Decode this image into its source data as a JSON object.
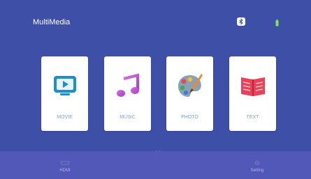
{
  "header": {
    "title": "MultiMedia",
    "bluetooth_icon": "bluetooth-icon",
    "battery_icon": "battery-icon"
  },
  "cards": [
    {
      "label": "MOVIE",
      "icon": "tv-play-icon"
    },
    {
      "label": "MUSIC",
      "icon": "music-note-icon"
    },
    {
      "label": "PHOTO",
      "icon": "palette-icon"
    },
    {
      "label": "TEXT",
      "icon": "book-icon"
    }
  ],
  "bottom_bar": {
    "items": [
      {
        "label": "HDMI",
        "icon": "hdmi-icon"
      },
      {
        "label": "Setting",
        "icon": "gear-icon"
      }
    ]
  },
  "colors": {
    "background": "#3e4fa8",
    "bottom_bar": "#5258b8",
    "card": "#ffffff",
    "card_label": "#7da0d8"
  }
}
